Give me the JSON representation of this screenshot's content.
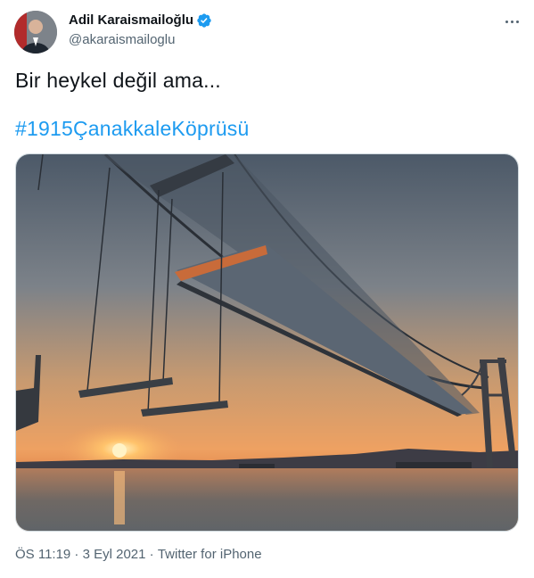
{
  "author": {
    "display_name": "Adil Karaismailoğlu",
    "handle": "@akaraismailoglu"
  },
  "icons": {
    "verified": "verified-badge-icon",
    "more": "more-options-icon"
  },
  "tweet": {
    "text": "Bir heykel değil ama...",
    "hashtag": "#1915ÇanakkaleKöprüsü"
  },
  "meta": {
    "time": "ÖS 11:19",
    "separator1": " · ",
    "date": "3 Eyl 2021",
    "separator2": " · ",
    "source": "Twitter for iPhone"
  },
  "colors": {
    "link": "#1d9bf0",
    "secondary_text": "#536471",
    "verified": "#1d9bf0"
  }
}
